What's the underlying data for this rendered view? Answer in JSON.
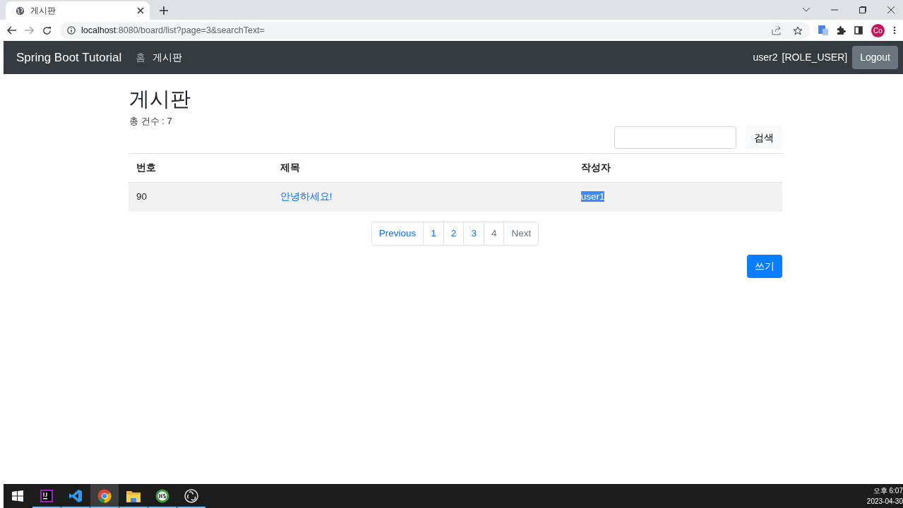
{
  "browser": {
    "tab_title": "게시판",
    "url_host": "localhost",
    "url_path": ":8080/board/list?page=3&searchText=",
    "profile": "Co"
  },
  "navbar": {
    "brand": "Spring Boot Tutorial",
    "links": [
      {
        "label": "홈",
        "selected": false
      },
      {
        "label": "게시판",
        "selected": true
      }
    ],
    "user": "user2",
    "role": "[ROLE_USER]",
    "logout": "Logout"
  },
  "board": {
    "title": "게시판",
    "count": "총 건수 : 7",
    "search_button": "검색",
    "columns": [
      "번호",
      "제목",
      "작성자"
    ],
    "rows": [
      {
        "number": "90",
        "title": "안녕하세요!",
        "author": "user1",
        "author_highlighted": true
      }
    ],
    "pagination": [
      {
        "label": "Previous",
        "disabled": false
      },
      {
        "label": "1",
        "disabled": false
      },
      {
        "label": "2",
        "disabled": false
      },
      {
        "label": "3",
        "disabled": false
      },
      {
        "label": "4",
        "disabled": true
      },
      {
        "label": "Next",
        "disabled": true
      }
    ],
    "write_button": "쓰기"
  },
  "taskbar": {
    "apps": [
      {
        "kind": "start",
        "active": false,
        "running": false
      },
      {
        "kind": "intellij",
        "active": false,
        "running": true
      },
      {
        "kind": "vscode",
        "active": false,
        "running": true
      },
      {
        "kind": "chrome",
        "active": true,
        "running": true
      },
      {
        "kind": "files",
        "active": false,
        "running": true
      },
      {
        "kind": "hs",
        "active": false,
        "running": true
      },
      {
        "kind": "obs",
        "active": false,
        "running": true
      }
    ],
    "time": "오후 6:07",
    "date": "2023-04-30"
  }
}
